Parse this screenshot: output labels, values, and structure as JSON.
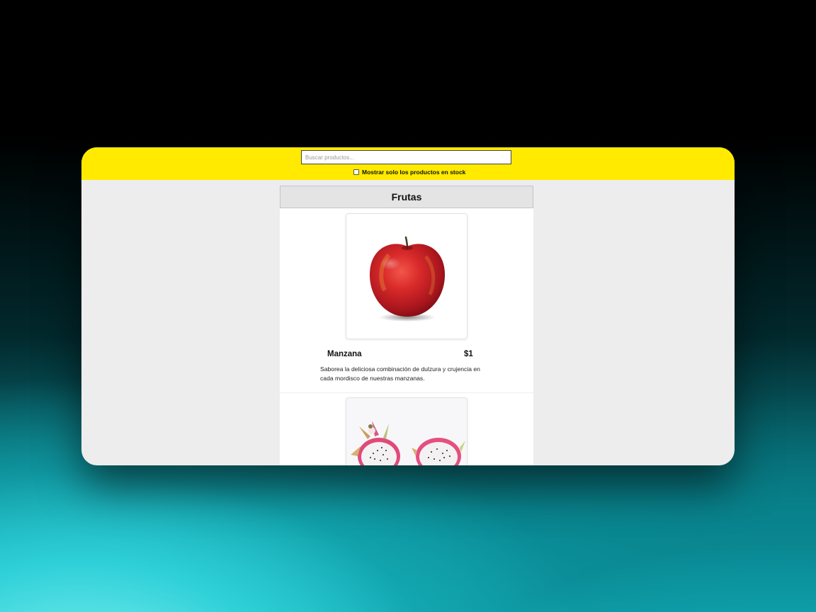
{
  "search": {
    "placeholder": "Buscar productos..."
  },
  "filter": {
    "stock_only_label": "Mostrar solo los productos en stock",
    "stock_only_checked": false
  },
  "category": {
    "title": "Frutas"
  },
  "products": [
    {
      "name": "Manzana",
      "price": "$1",
      "description": "Saborea la deliciosa combinación de dulzura y crujencia en cada mordisco de nuestras manzanas.",
      "image_icon": "apple-image"
    },
    {
      "image_icon": "dragon-fruit-image"
    }
  ],
  "colors": {
    "header_bar": "#ffea00",
    "page_background": "#ededed",
    "category_header": "#e4e4e4"
  }
}
